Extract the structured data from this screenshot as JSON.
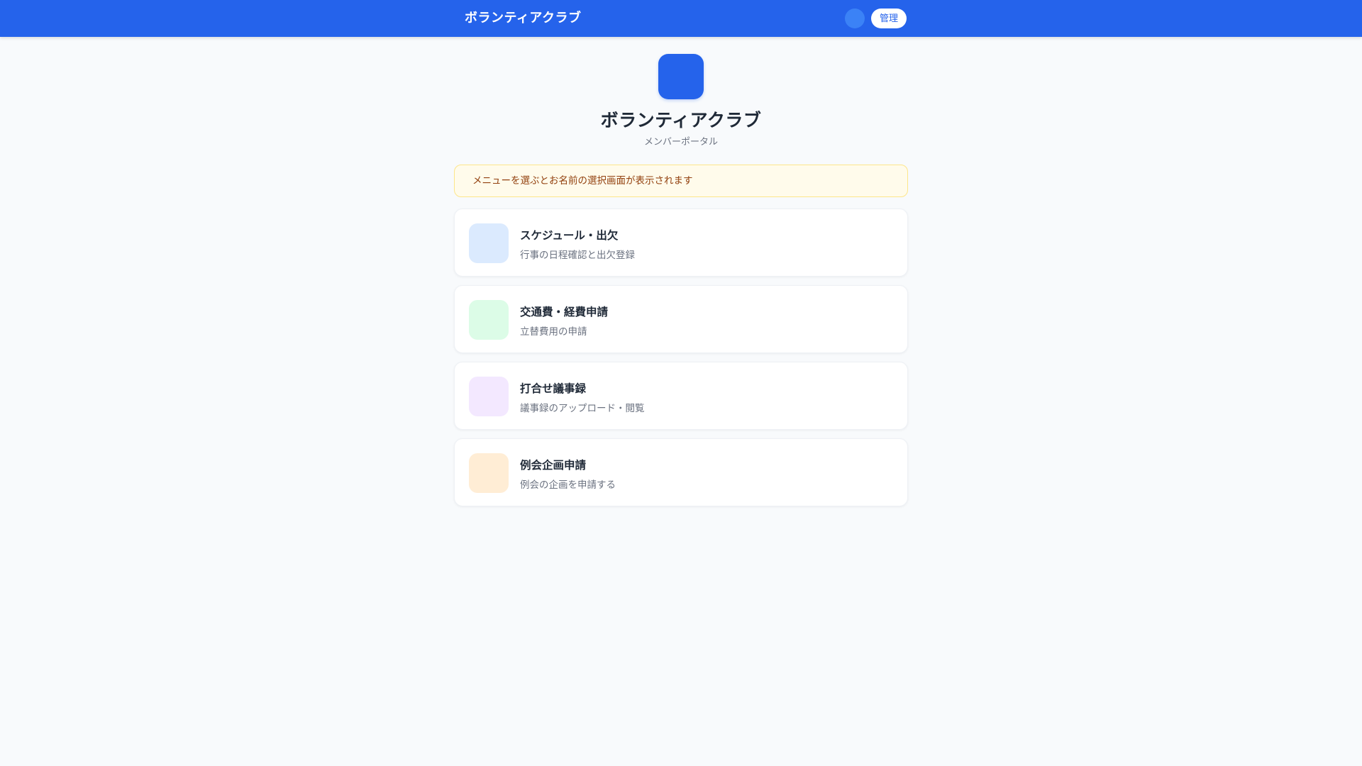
{
  "header": {
    "title": "ボランティアクラブ",
    "admin_label": "管理"
  },
  "hero": {
    "title": "ボランティアクラブ",
    "subtitle": "メンバーポータル"
  },
  "notice": {
    "text": "メニューを選ぶとお名前の選択画面が表示されます"
  },
  "menu": {
    "items": [
      {
        "title": "スケジュール・出欠",
        "description": "行事の日程確認と出欠登録",
        "icon_color": "#dbeafe",
        "icon": "calendar-icon"
      },
      {
        "title": "交通費・経費申請",
        "description": "立替費用の申請",
        "icon_color": "#dcfce7",
        "icon": "receipt-icon"
      },
      {
        "title": "打合せ議事録",
        "description": "議事録のアップロード・閲覧",
        "icon_color": "#f3e8ff",
        "icon": "document-icon"
      },
      {
        "title": "例会企画申請",
        "description": "例会の企画を申請する",
        "icon_color": "#ffedd5",
        "icon": "clipboard-icon"
      }
    ]
  },
  "colors": {
    "primary": "#2563eb",
    "background": "#f8fafc",
    "notice_background": "#fffbeb",
    "notice_text": "#92400e"
  }
}
